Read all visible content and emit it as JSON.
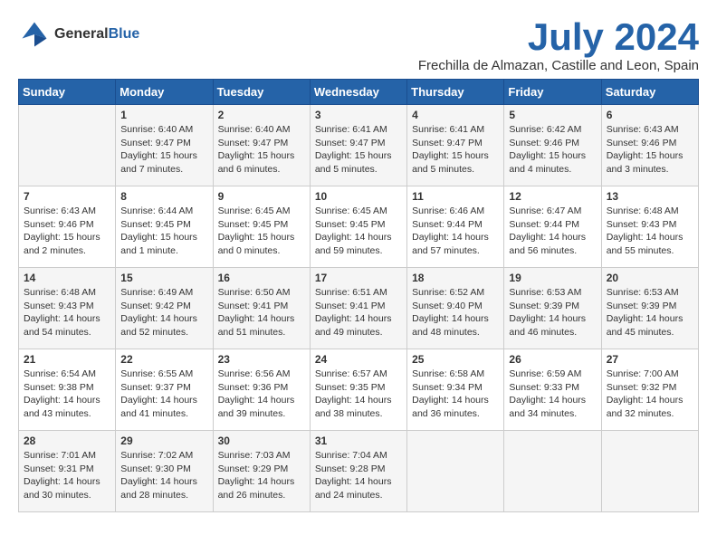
{
  "header": {
    "logo_line1": "General",
    "logo_line2": "Blue",
    "month_title": "July 2024",
    "location": "Frechilla de Almazan, Castille and Leon, Spain"
  },
  "days_of_week": [
    "Sunday",
    "Monday",
    "Tuesday",
    "Wednesday",
    "Thursday",
    "Friday",
    "Saturday"
  ],
  "weeks": [
    [
      {
        "day": "",
        "info": ""
      },
      {
        "day": "1",
        "info": "Sunrise: 6:40 AM\nSunset: 9:47 PM\nDaylight: 15 hours\nand 7 minutes."
      },
      {
        "day": "2",
        "info": "Sunrise: 6:40 AM\nSunset: 9:47 PM\nDaylight: 15 hours\nand 6 minutes."
      },
      {
        "day": "3",
        "info": "Sunrise: 6:41 AM\nSunset: 9:47 PM\nDaylight: 15 hours\nand 5 minutes."
      },
      {
        "day": "4",
        "info": "Sunrise: 6:41 AM\nSunset: 9:47 PM\nDaylight: 15 hours\nand 5 minutes."
      },
      {
        "day": "5",
        "info": "Sunrise: 6:42 AM\nSunset: 9:46 PM\nDaylight: 15 hours\nand 4 minutes."
      },
      {
        "day": "6",
        "info": "Sunrise: 6:43 AM\nSunset: 9:46 PM\nDaylight: 15 hours\nand 3 minutes."
      }
    ],
    [
      {
        "day": "7",
        "info": "Sunrise: 6:43 AM\nSunset: 9:46 PM\nDaylight: 15 hours\nand 2 minutes."
      },
      {
        "day": "8",
        "info": "Sunrise: 6:44 AM\nSunset: 9:45 PM\nDaylight: 15 hours\nand 1 minute."
      },
      {
        "day": "9",
        "info": "Sunrise: 6:45 AM\nSunset: 9:45 PM\nDaylight: 15 hours\nand 0 minutes."
      },
      {
        "day": "10",
        "info": "Sunrise: 6:45 AM\nSunset: 9:45 PM\nDaylight: 14 hours\nand 59 minutes."
      },
      {
        "day": "11",
        "info": "Sunrise: 6:46 AM\nSunset: 9:44 PM\nDaylight: 14 hours\nand 57 minutes."
      },
      {
        "day": "12",
        "info": "Sunrise: 6:47 AM\nSunset: 9:44 PM\nDaylight: 14 hours\nand 56 minutes."
      },
      {
        "day": "13",
        "info": "Sunrise: 6:48 AM\nSunset: 9:43 PM\nDaylight: 14 hours\nand 55 minutes."
      }
    ],
    [
      {
        "day": "14",
        "info": "Sunrise: 6:48 AM\nSunset: 9:43 PM\nDaylight: 14 hours\nand 54 minutes."
      },
      {
        "day": "15",
        "info": "Sunrise: 6:49 AM\nSunset: 9:42 PM\nDaylight: 14 hours\nand 52 minutes."
      },
      {
        "day": "16",
        "info": "Sunrise: 6:50 AM\nSunset: 9:41 PM\nDaylight: 14 hours\nand 51 minutes."
      },
      {
        "day": "17",
        "info": "Sunrise: 6:51 AM\nSunset: 9:41 PM\nDaylight: 14 hours\nand 49 minutes."
      },
      {
        "day": "18",
        "info": "Sunrise: 6:52 AM\nSunset: 9:40 PM\nDaylight: 14 hours\nand 48 minutes."
      },
      {
        "day": "19",
        "info": "Sunrise: 6:53 AM\nSunset: 9:39 PM\nDaylight: 14 hours\nand 46 minutes."
      },
      {
        "day": "20",
        "info": "Sunrise: 6:53 AM\nSunset: 9:39 PM\nDaylight: 14 hours\nand 45 minutes."
      }
    ],
    [
      {
        "day": "21",
        "info": "Sunrise: 6:54 AM\nSunset: 9:38 PM\nDaylight: 14 hours\nand 43 minutes."
      },
      {
        "day": "22",
        "info": "Sunrise: 6:55 AM\nSunset: 9:37 PM\nDaylight: 14 hours\nand 41 minutes."
      },
      {
        "day": "23",
        "info": "Sunrise: 6:56 AM\nSunset: 9:36 PM\nDaylight: 14 hours\nand 39 minutes."
      },
      {
        "day": "24",
        "info": "Sunrise: 6:57 AM\nSunset: 9:35 PM\nDaylight: 14 hours\nand 38 minutes."
      },
      {
        "day": "25",
        "info": "Sunrise: 6:58 AM\nSunset: 9:34 PM\nDaylight: 14 hours\nand 36 minutes."
      },
      {
        "day": "26",
        "info": "Sunrise: 6:59 AM\nSunset: 9:33 PM\nDaylight: 14 hours\nand 34 minutes."
      },
      {
        "day": "27",
        "info": "Sunrise: 7:00 AM\nSunset: 9:32 PM\nDaylight: 14 hours\nand 32 minutes."
      }
    ],
    [
      {
        "day": "28",
        "info": "Sunrise: 7:01 AM\nSunset: 9:31 PM\nDaylight: 14 hours\nand 30 minutes."
      },
      {
        "day": "29",
        "info": "Sunrise: 7:02 AM\nSunset: 9:30 PM\nDaylight: 14 hours\nand 28 minutes."
      },
      {
        "day": "30",
        "info": "Sunrise: 7:03 AM\nSunset: 9:29 PM\nDaylight: 14 hours\nand 26 minutes."
      },
      {
        "day": "31",
        "info": "Sunrise: 7:04 AM\nSunset: 9:28 PM\nDaylight: 14 hours\nand 24 minutes."
      },
      {
        "day": "",
        "info": ""
      },
      {
        "day": "",
        "info": ""
      },
      {
        "day": "",
        "info": ""
      }
    ]
  ]
}
